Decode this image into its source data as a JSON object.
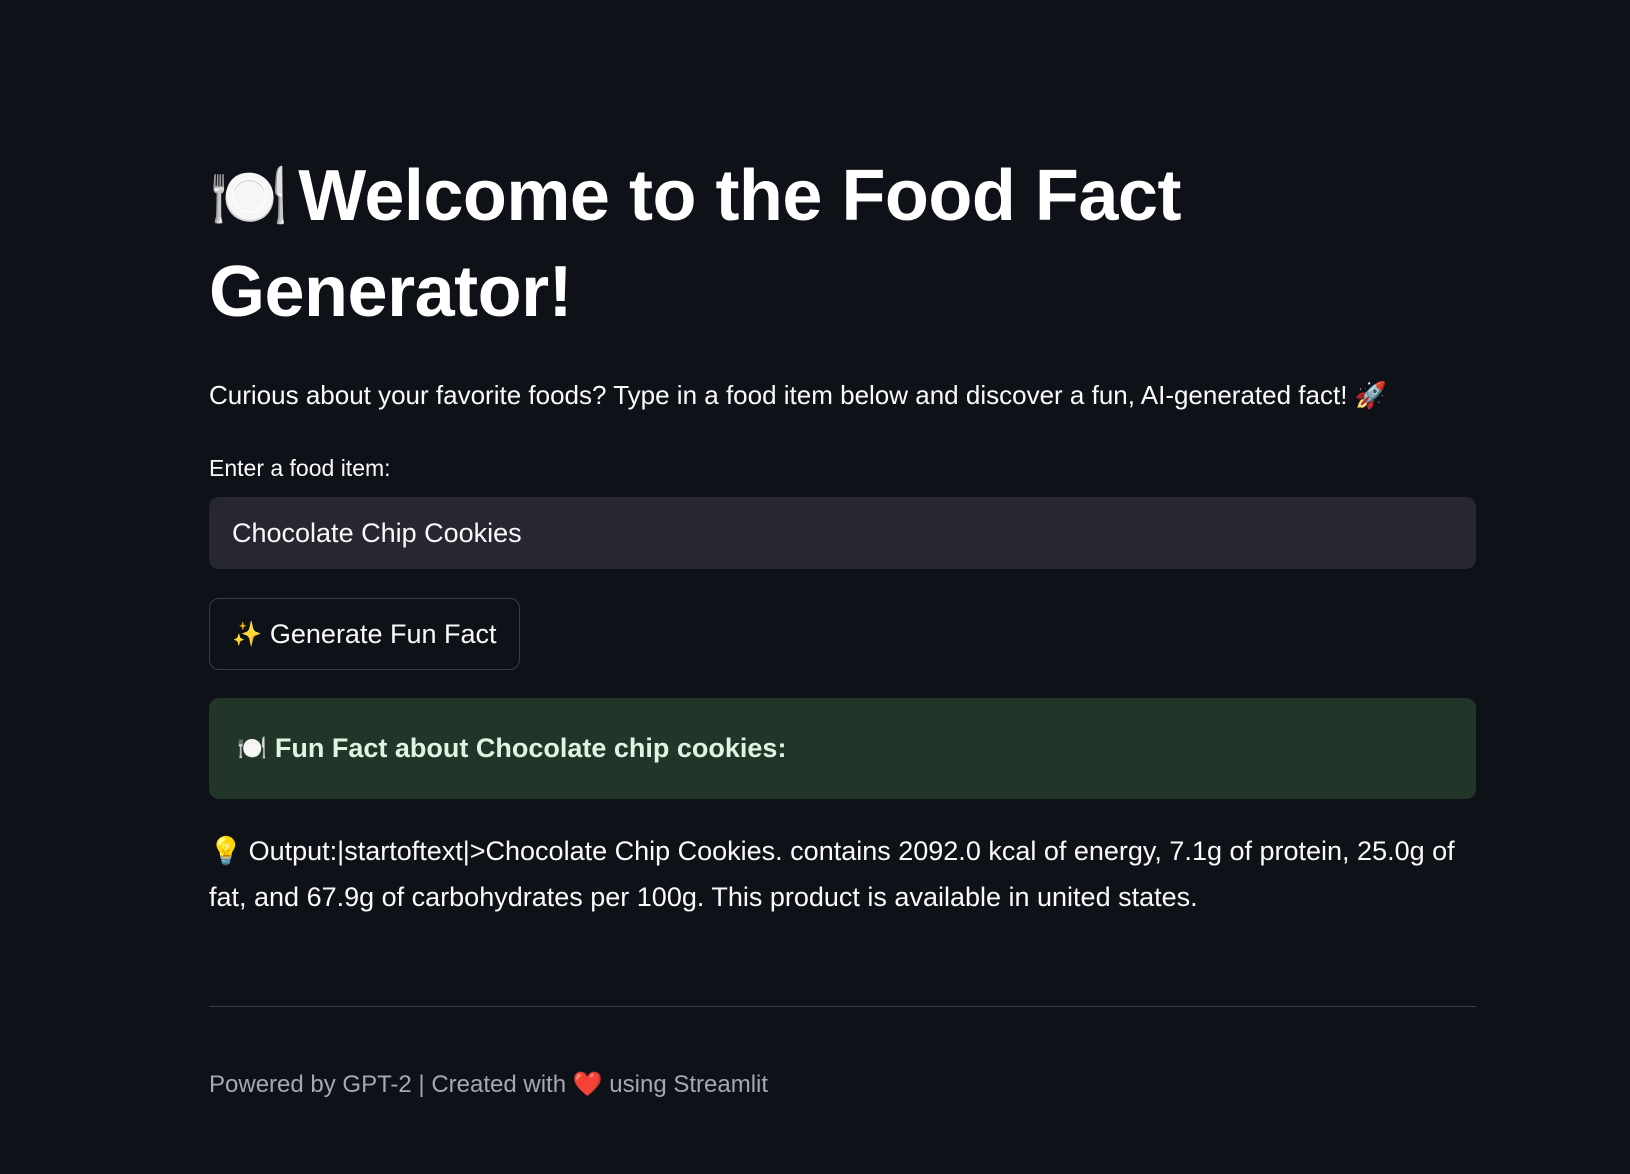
{
  "title": {
    "emoji": "🍽️",
    "text": "Welcome to the Food Fact Generator!"
  },
  "intro": {
    "text": "Curious about your favorite foods? Type in a food item below and discover a fun, AI-generated fact! 🚀"
  },
  "food_input": {
    "label": "Enter a food item:",
    "value": "Chocolate Chip Cookies"
  },
  "generate_button": {
    "icon": "✨",
    "label": "Generate Fun Fact"
  },
  "result_header": {
    "emoji": "🍽️",
    "text": "Fun Fact about Chocolate chip cookies:"
  },
  "output": {
    "icon": "💡",
    "text": "Output:|startoftext|>Chocolate Chip Cookies. contains 2092.0 kcal of energy, 7.1g of protein, 25.0g of fat, and 67.9g of carbohydrates per 100g. This product is available in united states."
  },
  "footer": {
    "prefix": "Powered by GPT-2 | Created with",
    "heart": "❤️",
    "suffix": "using Streamlit"
  },
  "colors": {
    "background": "#0e1117",
    "input_background": "#262730",
    "success_background": "#213629",
    "footer_text": "#a3a8b4"
  }
}
